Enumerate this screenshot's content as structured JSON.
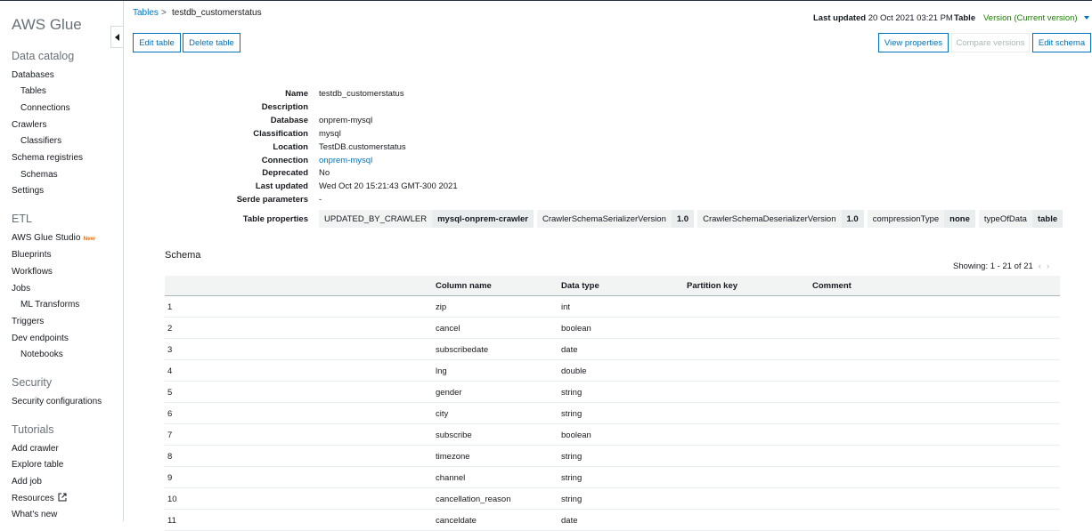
{
  "sidebar": {
    "brand": "AWS Glue",
    "sections": {
      "data_catalog": "Data catalog",
      "etl": "ETL",
      "security": "Security",
      "tutorials": "Tutorials"
    },
    "items": {
      "databases": "Databases",
      "tables": "Tables",
      "connections": "Connections",
      "crawlers": "Crawlers",
      "classifiers": "Classifiers",
      "schema_registries": "Schema registries",
      "schemas": "Schemas",
      "settings": "Settings",
      "glue_studio": "AWS Glue Studio",
      "glue_studio_badge": "New",
      "blueprints": "Blueprints",
      "workflows": "Workflows",
      "jobs": "Jobs",
      "ml_transforms": "ML Transforms",
      "triggers": "Triggers",
      "dev_endpoints": "Dev endpoints",
      "notebooks": "Notebooks",
      "security_configurations": "Security configurations",
      "add_crawler": "Add crawler",
      "explore_table": "Explore table",
      "add_job": "Add job",
      "resources": "Resources",
      "whats_new": "What's new"
    }
  },
  "header": {
    "breadcrumb_link": "Tables",
    "breadcrumb_sep": ">",
    "breadcrumb_current": "testdb_customerstatus",
    "last_updated_label": "Last updated",
    "last_updated_value": "20 Oct 2021 03:21 PM",
    "table_label": "Table",
    "version_value": "Version (Current version)"
  },
  "buttons": {
    "edit_table": "Edit table",
    "delete_table": "Delete table",
    "view_properties": "View properties",
    "compare_versions": "Compare versions",
    "edit_schema": "Edit schema"
  },
  "details": {
    "name_label": "Name",
    "name_value": "testdb_customerstatus",
    "description_label": "Description",
    "description_value": "",
    "database_label": "Database",
    "database_value": "onprem-mysql",
    "classification_label": "Classification",
    "classification_value": "mysql",
    "location_label": "Location",
    "location_value": "TestDB.customerstatus",
    "connection_label": "Connection",
    "connection_value": "onprem-mysql",
    "deprecated_label": "Deprecated",
    "deprecated_value": "No",
    "last_updated_label": "Last updated",
    "last_updated_value": "Wed Oct 20 15:21:43 GMT-300 2021",
    "serde_label": "Serde parameters",
    "serde_value": "-",
    "table_properties_label": "Table properties",
    "table_properties": [
      {
        "key": "UPDATED_BY_CRAWLER",
        "value": "mysql-onprem-crawler"
      },
      {
        "key": "CrawlerSchemaSerializerVersion",
        "value": "1.0"
      },
      {
        "key": "CrawlerSchemaDeserializerVersion",
        "value": "1.0"
      },
      {
        "key": "compressionType",
        "value": "none"
      },
      {
        "key": "typeOfData",
        "value": "table"
      }
    ]
  },
  "schema": {
    "title": "Schema",
    "showing": "Showing: 1 - 21 of 21",
    "headers": [
      "",
      "Column name",
      "Data type",
      "Partition key",
      "Comment"
    ],
    "rows": [
      [
        "1",
        "zip",
        "int"
      ],
      [
        "2",
        "cancel",
        "boolean"
      ],
      [
        "3",
        "subscribedate",
        "date"
      ],
      [
        "4",
        "lng",
        "double"
      ],
      [
        "5",
        "gender",
        "string"
      ],
      [
        "6",
        "city",
        "string"
      ],
      [
        "7",
        "subscribe",
        "boolean"
      ],
      [
        "8",
        "timezone",
        "string"
      ],
      [
        "9",
        "channel",
        "string"
      ],
      [
        "10",
        "cancellation_reason",
        "string"
      ],
      [
        "11",
        "canceldate",
        "date"
      ]
    ]
  }
}
